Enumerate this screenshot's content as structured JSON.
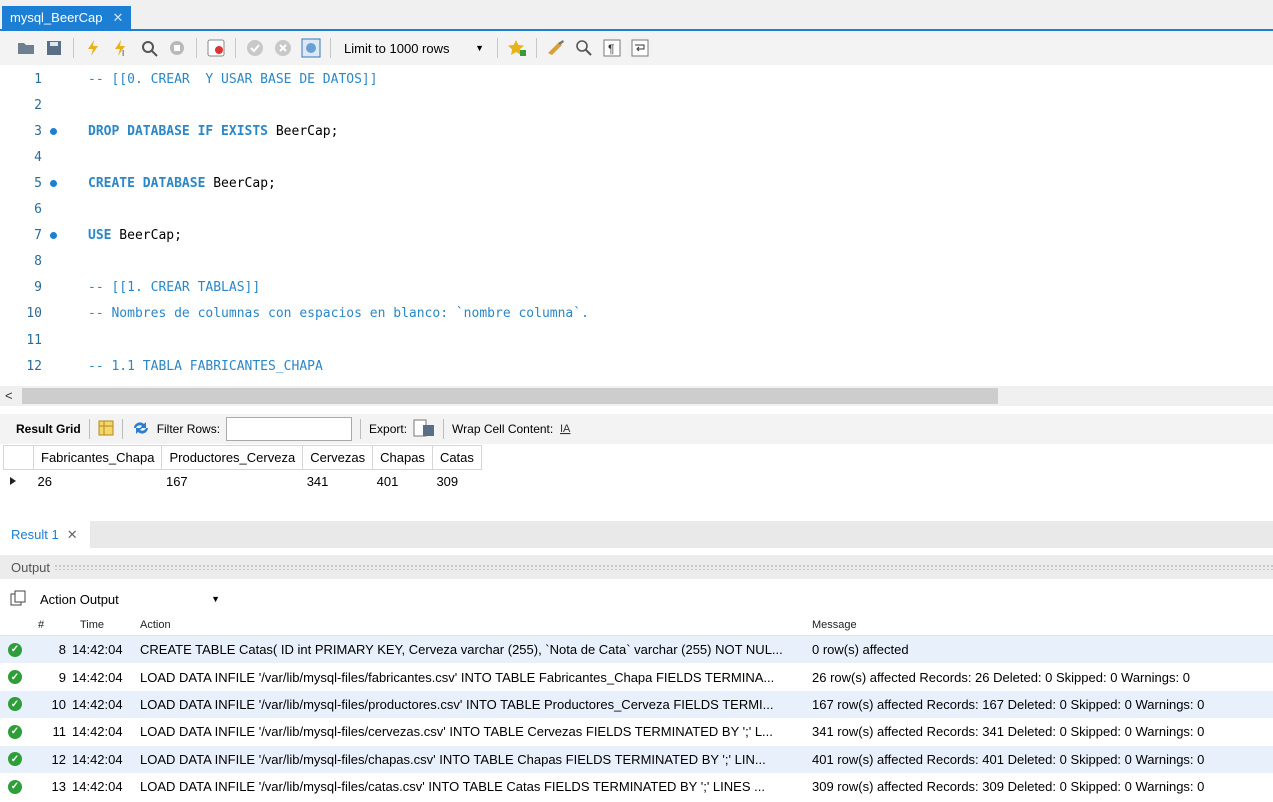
{
  "tab": {
    "title": "mysql_BeerCap"
  },
  "toolbar": {
    "limit_label": "Limit to 1000 rows"
  },
  "editor": {
    "lines": [
      {
        "n": "1",
        "dot": false,
        "kind": "cmt",
        "text": "-- [[0. CREAR  Y USAR BASE DE DATOS]]"
      },
      {
        "n": "2",
        "dot": false,
        "kind": "plain",
        "text": ""
      },
      {
        "n": "3",
        "dot": true,
        "kind": "kwplain",
        "kw": "DROP DATABASE IF EXISTS",
        "rest": " BeerCap;"
      },
      {
        "n": "4",
        "dot": false,
        "kind": "plain",
        "text": ""
      },
      {
        "n": "5",
        "dot": true,
        "kind": "kwplain",
        "kw": "CREATE DATABASE",
        "rest": " BeerCap;"
      },
      {
        "n": "6",
        "dot": false,
        "kind": "plain",
        "text": ""
      },
      {
        "n": "7",
        "dot": true,
        "kind": "kwplain",
        "kw": "USE",
        "rest": " BeerCap;"
      },
      {
        "n": "8",
        "dot": false,
        "kind": "plain",
        "text": ""
      },
      {
        "n": "9",
        "dot": false,
        "kind": "cmt",
        "text": "-- [[1. CREAR TABLAS]]"
      },
      {
        "n": "10",
        "dot": false,
        "kind": "cmt",
        "text": "-- Nombres de columnas con espacios en blanco: `nombre columna`."
      },
      {
        "n": "11",
        "dot": false,
        "kind": "plain",
        "text": ""
      },
      {
        "n": "12",
        "dot": false,
        "kind": "cmt",
        "text": "-- 1.1 TABLA FABRICANTES_CHAPA"
      }
    ]
  },
  "resultbar": {
    "result_grid": "Result Grid",
    "filter_rows": "Filter Rows:",
    "export": "Export:",
    "wrap": "Wrap Cell Content:"
  },
  "grid": {
    "columns": [
      "Fabricantes_Chapa",
      "Productores_Cerveza",
      "Cervezas",
      "Chapas",
      "Catas"
    ],
    "row": [
      "26",
      "167",
      "341",
      "401",
      "309"
    ]
  },
  "result_tab": {
    "label": "Result 1"
  },
  "output": {
    "header": "Output",
    "select": "Action Output",
    "columns": {
      "num": "#",
      "time": "Time",
      "action": "Action",
      "message": "Message"
    },
    "rows": [
      {
        "num": "8",
        "time": "14:42:04",
        "action": "CREATE TABLE Catas( ID int PRIMARY KEY, Cerveza varchar (255), `Nota de Cata` varchar (255) NOT NUL...",
        "message": "0 row(s) affected"
      },
      {
        "num": "9",
        "time": "14:42:04",
        "action": "LOAD DATA INFILE '/var/lib/mysql-files/fabricantes.csv' INTO TABLE Fabricantes_Chapa FIELDS TERMINA...",
        "message": "26 row(s) affected Records: 26  Deleted: 0  Skipped: 0  Warnings: 0"
      },
      {
        "num": "10",
        "time": "14:42:04",
        "action": "LOAD DATA INFILE '/var/lib/mysql-files/productores.csv' INTO TABLE Productores_Cerveza FIELDS TERMI...",
        "message": "167 row(s) affected Records: 167  Deleted: 0  Skipped: 0  Warnings: 0"
      },
      {
        "num": "11",
        "time": "14:42:04",
        "action": "LOAD DATA INFILE '/var/lib/mysql-files/cervezas.csv' INTO TABLE Cervezas FIELDS TERMINATED BY ';' L...",
        "message": "341 row(s) affected Records: 341  Deleted: 0  Skipped: 0  Warnings: 0"
      },
      {
        "num": "12",
        "time": "14:42:04",
        "action": "LOAD DATA INFILE '/var/lib/mysql-files/chapas.csv' INTO TABLE Chapas FIELDS TERMINATED BY ';' LIN...",
        "message": "401 row(s) affected Records: 401  Deleted: 0  Skipped: 0  Warnings: 0"
      },
      {
        "num": "13",
        "time": "14:42:04",
        "action": "LOAD DATA INFILE '/var/lib/mysql-files/catas.csv' INTO TABLE Catas FIELDS TERMINATED BY ';' LINES ...",
        "message": "309 row(s) affected Records: 309  Deleted: 0  Skipped: 0  Warnings: 0"
      }
    ]
  }
}
